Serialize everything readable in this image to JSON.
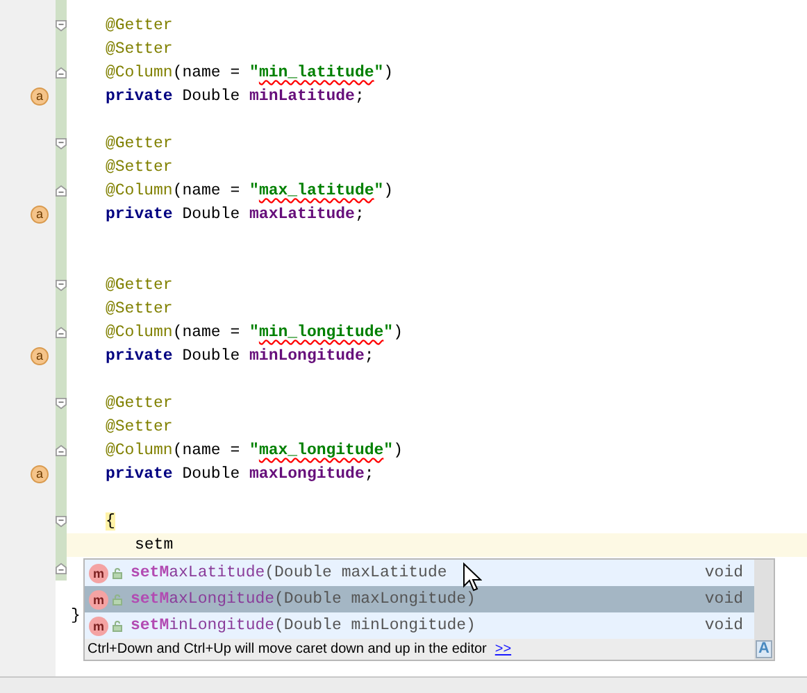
{
  "editor": {
    "lines": [
      {
        "kind": "member",
        "current": false,
        "fold_start": true,
        "tokens": [
          {
            "kind": "annotation",
            "text": "@Getter"
          }
        ]
      },
      {
        "kind": "member",
        "current": false,
        "tokens": [
          {
            "kind": "annotation",
            "text": "@Setter"
          }
        ]
      },
      {
        "kind": "member",
        "current": false,
        "fold_end": true,
        "tokens": [
          {
            "kind": "annotation",
            "text": "@Column"
          },
          {
            "kind": "plain",
            "text": "(name = "
          },
          {
            "kind": "string",
            "text": "\""
          },
          {
            "kind": "string_typo",
            "text": "min_latitude"
          },
          {
            "kind": "string",
            "text": "\""
          },
          {
            "kind": "plain",
            "text": ")"
          }
        ]
      },
      {
        "kind": "member",
        "current": false,
        "gutter_mark": "a",
        "tokens": [
          {
            "kind": "keyword",
            "text": "private"
          },
          {
            "kind": "plain",
            "text": " Double "
          },
          {
            "kind": "field",
            "text": "minLatitude"
          },
          {
            "kind": "plain",
            "text": ";"
          }
        ]
      },
      {
        "kind": "blank",
        "current": false
      },
      {
        "kind": "member",
        "current": false,
        "fold_start": true,
        "tokens": [
          {
            "kind": "annotation",
            "text": "@Getter"
          }
        ]
      },
      {
        "kind": "member",
        "current": false,
        "tokens": [
          {
            "kind": "annotation",
            "text": "@Setter"
          }
        ]
      },
      {
        "kind": "member",
        "current": false,
        "fold_end": true,
        "tokens": [
          {
            "kind": "annotation",
            "text": "@Column"
          },
          {
            "kind": "plain",
            "text": "(name = "
          },
          {
            "kind": "string",
            "text": "\""
          },
          {
            "kind": "string_typo",
            "text": "max_latitude"
          },
          {
            "kind": "string",
            "text": "\""
          },
          {
            "kind": "plain",
            "text": ")"
          }
        ]
      },
      {
        "kind": "member",
        "current": false,
        "gutter_mark": "a",
        "tokens": [
          {
            "kind": "keyword",
            "text": "private"
          },
          {
            "kind": "plain",
            "text": " Double "
          },
          {
            "kind": "field",
            "text": "maxLatitude"
          },
          {
            "kind": "plain",
            "text": ";"
          }
        ]
      },
      {
        "kind": "blank",
        "current": false
      },
      {
        "kind": "blank",
        "current": false
      },
      {
        "kind": "member",
        "current": false,
        "fold_start": true,
        "tokens": [
          {
            "kind": "annotation",
            "text": "@Getter"
          }
        ]
      },
      {
        "kind": "member",
        "current": false,
        "tokens": [
          {
            "kind": "annotation",
            "text": "@Setter"
          }
        ]
      },
      {
        "kind": "member",
        "current": false,
        "fold_end": true,
        "tokens": [
          {
            "kind": "annotation",
            "text": "@Column"
          },
          {
            "kind": "plain",
            "text": "(name = "
          },
          {
            "kind": "string",
            "text": "\""
          },
          {
            "kind": "string_typo",
            "text": "min_longitude"
          },
          {
            "kind": "string",
            "text": "\""
          },
          {
            "kind": "plain",
            "text": ")"
          }
        ]
      },
      {
        "kind": "member",
        "current": false,
        "gutter_mark": "a",
        "tokens": [
          {
            "kind": "keyword",
            "text": "private"
          },
          {
            "kind": "plain",
            "text": " Double "
          },
          {
            "kind": "field",
            "text": "minLongitude"
          },
          {
            "kind": "plain",
            "text": ";"
          }
        ]
      },
      {
        "kind": "blank",
        "current": false
      },
      {
        "kind": "member",
        "current": false,
        "fold_start": true,
        "tokens": [
          {
            "kind": "annotation",
            "text": "@Getter"
          }
        ]
      },
      {
        "kind": "member",
        "current": false,
        "tokens": [
          {
            "kind": "annotation",
            "text": "@Setter"
          }
        ]
      },
      {
        "kind": "member",
        "current": false,
        "fold_end": true,
        "tokens": [
          {
            "kind": "annotation",
            "text": "@Column"
          },
          {
            "kind": "plain",
            "text": "(name = "
          },
          {
            "kind": "string",
            "text": "\""
          },
          {
            "kind": "string_typo",
            "text": "max_longitude"
          },
          {
            "kind": "string",
            "text": "\""
          },
          {
            "kind": "plain",
            "text": ")"
          }
        ]
      },
      {
        "kind": "member",
        "current": false,
        "gutter_mark": "a",
        "tokens": [
          {
            "kind": "keyword",
            "text": "private"
          },
          {
            "kind": "plain",
            "text": " Double "
          },
          {
            "kind": "field",
            "text": "maxLongitude"
          },
          {
            "kind": "plain",
            "text": ";"
          }
        ]
      },
      {
        "kind": "blank",
        "current": false
      },
      {
        "kind": "member",
        "current": false,
        "fold_start": true,
        "tokens": [
          {
            "kind": "brace_match",
            "text": "{"
          }
        ]
      },
      {
        "kind": "body",
        "current": true,
        "tokens": [
          {
            "kind": "plain",
            "text": "setm"
          }
        ]
      },
      {
        "kind": "blank",
        "current": false,
        "fold_end": true
      },
      {
        "kind": "blank",
        "current": false
      },
      {
        "kind": "class_end",
        "current": false,
        "tokens": [
          {
            "kind": "plain",
            "text": "}"
          }
        ]
      }
    ]
  },
  "completion": {
    "items": [
      {
        "icon_letter": "m",
        "match": "setM",
        "rest": "axLatitude",
        "params": "(Double maxLatitude",
        "type": "void",
        "selected": false
      },
      {
        "icon_letter": "m",
        "match": "setM",
        "rest": "axLongitude",
        "params": "(Double maxLongitude)",
        "type": "void",
        "selected": true
      },
      {
        "icon_letter": "m",
        "match": "setM",
        "rest": "inLongitude",
        "params": "(Double minLongitude)",
        "type": "void",
        "selected": false
      }
    ],
    "hint": "Ctrl+Down and Ctrl+Up will move caret down and up in the editor",
    "hint_link": ">>",
    "corner_letter": "A"
  }
}
